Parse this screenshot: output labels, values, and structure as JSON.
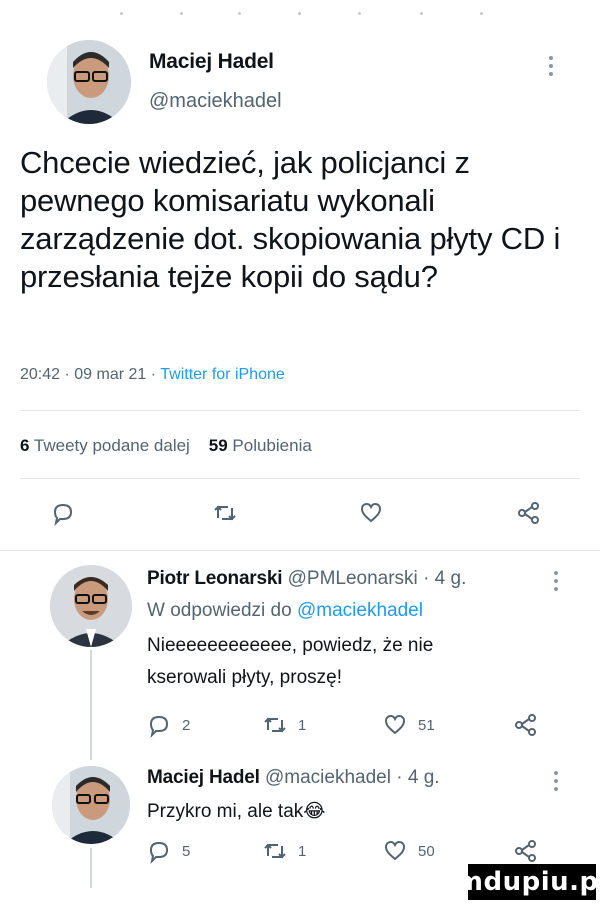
{
  "main_tweet": {
    "author_name": "Maciej Hadel",
    "author_handle": "@maciekhadel",
    "text": "Chcecie wiedzieć, jak policjanci z pewnego komisariatu wykonali zarządzenie dot. skopiowania płyty CD i przesłania tejże kopii do sądu?",
    "time": "20:42",
    "date": "09 mar 21",
    "client": "Twitter for iPhone",
    "retweets_count": "6",
    "retweets_label": "Tweety podane dalej",
    "likes_count": "59",
    "likes_label": "Polubienia"
  },
  "replies": [
    {
      "author_name": "Piotr Leonarski",
      "author_handle": "@PMLeonarski",
      "age": "4 g.",
      "reply_to_label": "W odpowiedzi do",
      "reply_to_handle": "@maciekhadel",
      "text_line1": "Nieeeeeeeeeeee, powiedz, że nie",
      "text_line2": "kserowali płyty, proszę!",
      "replies": "2",
      "retweets": "1",
      "likes": "51"
    },
    {
      "author_name": "Maciej Hadel",
      "author_handle": "@maciekhadel",
      "age": "4 g.",
      "text": "Przykro mi, ale tak😂",
      "replies": "5",
      "retweets": "1",
      "likes": "50"
    }
  ],
  "separator": "·",
  "watermark": "mdupiu.pl",
  "colors": {
    "accent": "#1d9bf0",
    "muted": "#536471",
    "text": "#0f1419"
  }
}
